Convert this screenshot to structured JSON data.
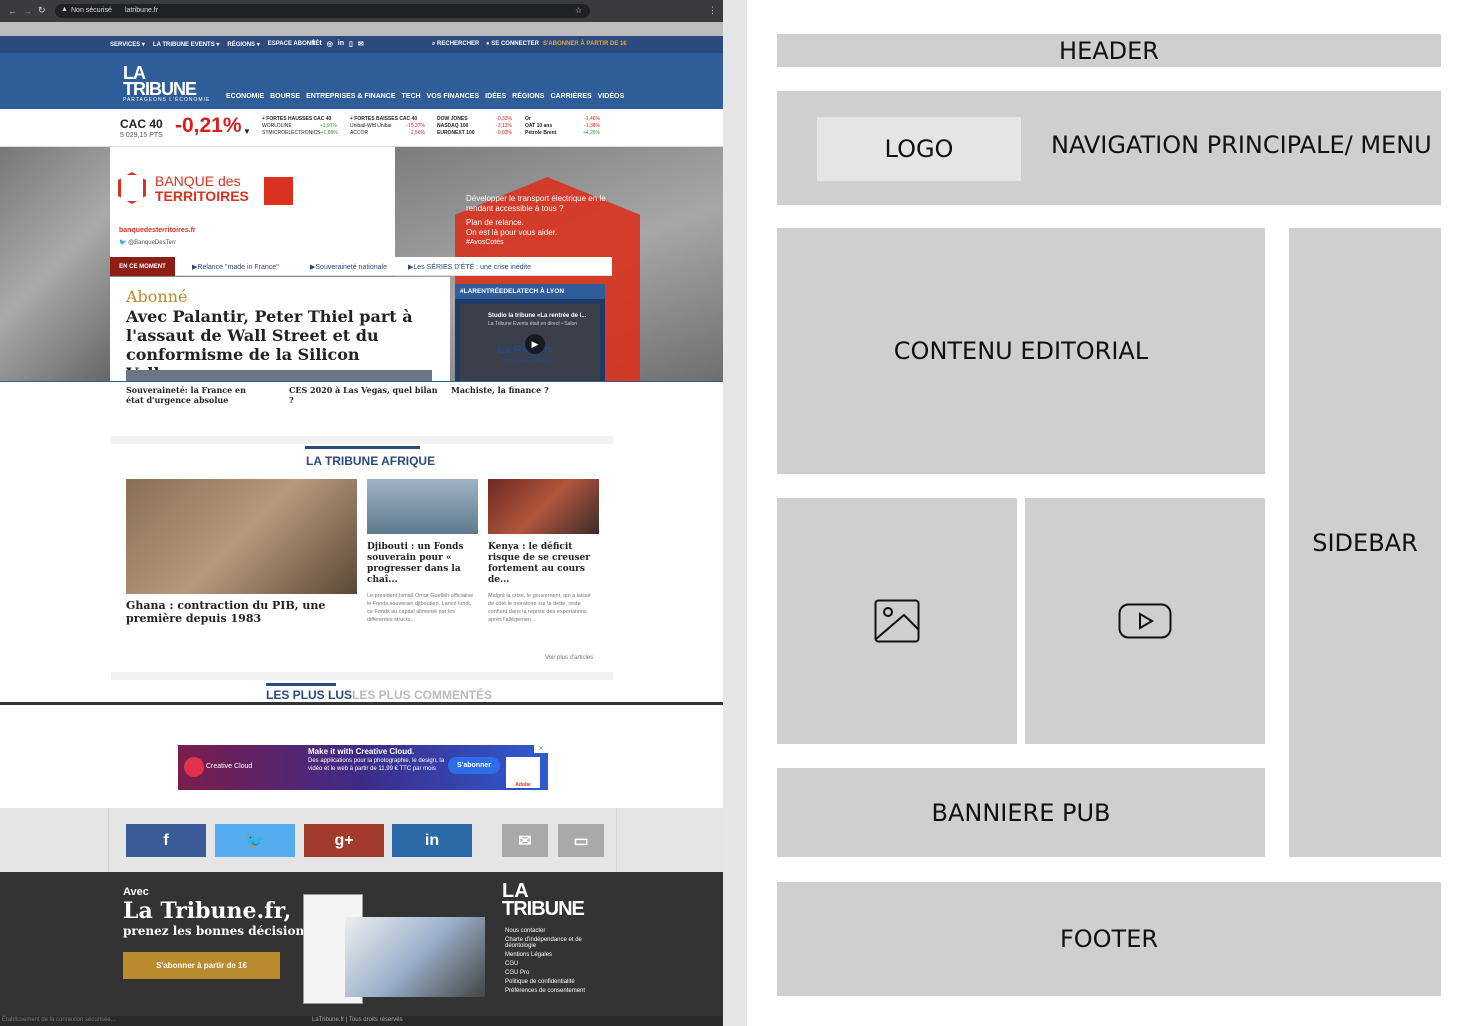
{
  "browser": {
    "security_label": "Non sécurisé",
    "url": "latribune.fr",
    "status_text": "Établissement de la connexion sécurisée..."
  },
  "topnav": {
    "items": [
      "SERVICES ▾",
      "LA TRIBUNE EVENTS ▾",
      "RÉGIONS ▾",
      "ESPACE ABONNÉ"
    ],
    "search": "RECHERCHER",
    "login": "SE CONNECTER",
    "subscribe": "S'ABONNER À PARTIR DE 1€"
  },
  "logo": {
    "line1": "LA",
    "line2": "TRIBUNE",
    "tagline": "PARTAGEONS L'ÉCONOMIE"
  },
  "menu": [
    "ECONOMIE",
    "BOURSE",
    "ENTREPRISES & FINANCE",
    "TECH",
    "VOS FINANCES",
    "IDÉES",
    "RÉGIONS",
    "CARRIÈRES",
    "VIDÉOS"
  ],
  "ticker": {
    "index_name": "CAC 40",
    "index_pts": "5 029,15 PTS",
    "index_change": "-0,21%",
    "hausses_title": "+ FORTES HAUSSES CAC 40",
    "hausses": [
      {
        "name": "WORLDLINE",
        "val": "+1,91%"
      },
      {
        "name": "STMICROELECTRONICS",
        "val": "+1,88%"
      }
    ],
    "baisses_title": "+ FORTES BAISSES CAC 40",
    "baisses": [
      {
        "name": "Unibail-Wfd Unibai",
        "val": "-15,37%"
      },
      {
        "name": "ACCOR",
        "val": "-2,56%"
      }
    ],
    "indices": [
      {
        "name": "DOW JONES",
        "val": "-0,33%"
      },
      {
        "name": "NASDAQ 100",
        "val": "-3,13%"
      },
      {
        "name": "EURONEXT 100",
        "val": "-0,03%"
      }
    ],
    "others": [
      {
        "name": "Or",
        "val": "-1,46%"
      },
      {
        "name": "OAT 10 ans",
        "val": "-1,38%"
      },
      {
        "name": "Pétrole Brent",
        "val": "+4,25%"
      }
    ]
  },
  "ad_banque": {
    "brand1": "BANQUE des",
    "brand2": "TERRITOIRES",
    "site": "banquedesterritoires.fr",
    "handle": "@BanqueDesTerr",
    "msg1": "Développer le transport électrique en le rendant accessible à tous ?",
    "msg2": "Plan de relance.",
    "msg3": "On est là pour vous aider.",
    "hashtag": "#AvosCotés"
  },
  "en_ce_moment": {
    "label": "EN CE MOMENT",
    "items": [
      "▶Relance \"made in France\"",
      "▶Souveraineté nationale",
      "▶Les SÉRIES D'ÉTÉ : une crise inédite"
    ]
  },
  "headline": {
    "kicker": "Abonné",
    "title": "Avec Palantir, Peter Thiel part à l'assaut de Wall Street et du conformisme de la Silicon Valley"
  },
  "video_box": {
    "tag": "#LARENTRÉEDELATECH À LYON",
    "title": "Studio la tribune «La rentrée de l...",
    "subtitle": "La Tribune Events était en direct • Salon",
    "region": "La Région",
    "region_sub": "Auvergne-Rhône-Alpes"
  },
  "sub_headlines": [
    "Souveraineté: la France en état d'urgence absolue",
    "CES 2020 à Las Vegas, quel bilan ?",
    "Machiste, la finance ?"
  ],
  "afrique": {
    "title": "LA TRIBUNE AFRIQUE",
    "main_title": "Ghana : contraction du PIB, une première depuis 1983",
    "cards": [
      {
        "title": "Djibouti : un Fonds souverain pour « progresser dans la chaî...",
        "text": "Le président Ismaïl Omar Guelleh officialise le Fonds souverain djiboutien. Lancé lundi, ce Fonds au capital alimenté par les différentes structu..."
      },
      {
        "title": "Kenya : le déficit risque de se creuser fortement au cours de...",
        "text": "Malgré la crise, le gouvernent, qui a laissé de côté le moratoire sur la dette, reste confiant dans la reprise des exportations après l'allègemen..."
      }
    ],
    "more": "Voir plus d'articles"
  },
  "tabs": {
    "lus": "LES PLUS LUS",
    "commentes": "LES PLUS COMMENTÉS"
  },
  "adobe_ad": {
    "brand": "Creative Cloud",
    "title": "Make it with Creative Cloud.",
    "text": "Des applications pour la photographie, le design, la vidéo et le web à partir de 11,99 € TTC par mois",
    "cta": "S'abonner",
    "vendor": "Adobe"
  },
  "share": {
    "fb": "f",
    "tw": "🐦",
    "gp": "g+",
    "li": "in",
    "mail": "✉",
    "tablet": "▭"
  },
  "footer": {
    "avec": "Avec",
    "brand": "La Tribune.fr,",
    "slogan": "prenez les bonnes décisions",
    "cta": "S'abonner à partir de 1€",
    "logo1": "LA",
    "logo2": "TRIBUNE",
    "links": [
      "Nous contacter",
      "Charte d'indépendance et de déontologie",
      "Mentions Légales",
      "CGU",
      "CGU Pro",
      "Politique de confidentialité",
      "Préférences de consentement"
    ],
    "copyright": "LaTribune.fr | Tous droits réservés"
  },
  "wireframe": {
    "header": "HEADER",
    "logo": "LOGO",
    "nav": "NAVIGATION PRINCIPALE/ MENU",
    "editorial": "CONTENU EDITORIAL",
    "sidebar": "SIDEBAR",
    "banner": "BANNIERE PUB",
    "footer": "FOOTER"
  },
  "colors": {
    "nav_dark": "#2b4a7d",
    "nav_blue": "#2e5d9a",
    "red": "#d6201f",
    "gold": "#b98a2e",
    "wire_gray": "#cfcfcf"
  }
}
